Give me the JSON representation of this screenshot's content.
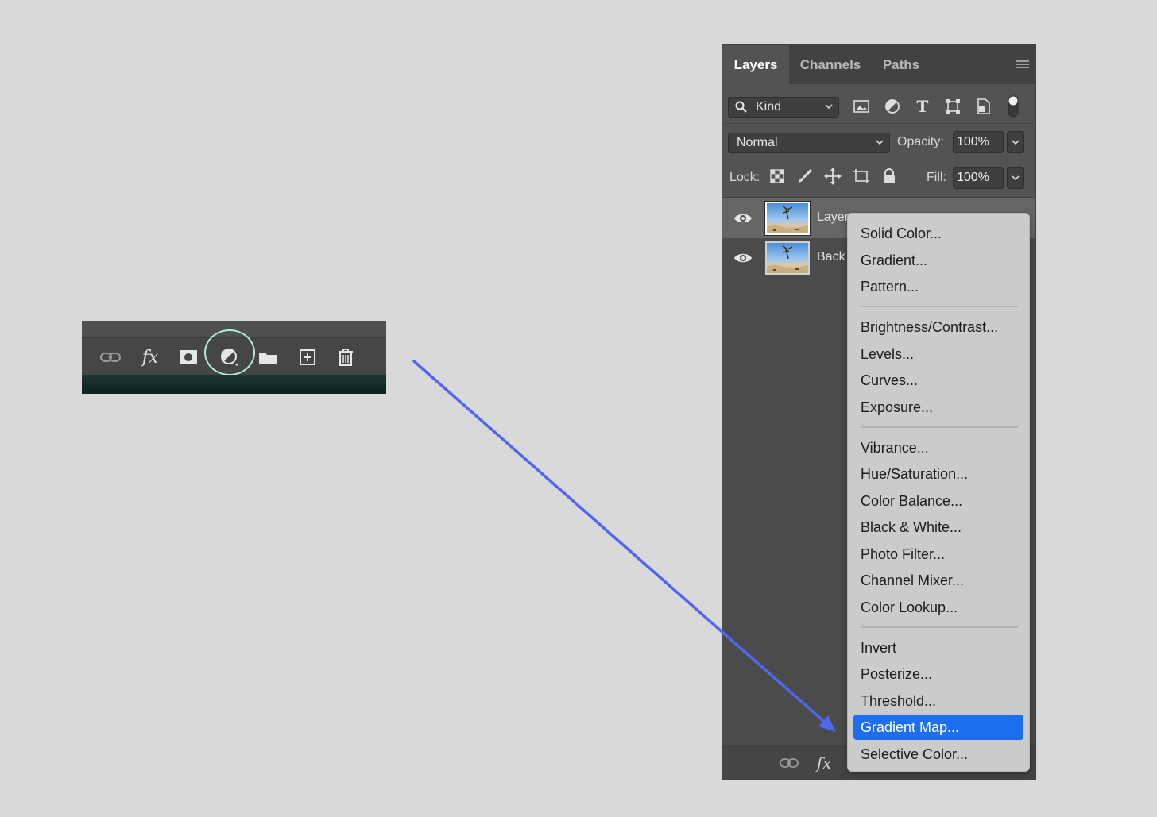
{
  "left_toolbar": {
    "icons": [
      "link-icon",
      "fx-icon",
      "mask-icon",
      "adjustment-layer-icon",
      "folder-icon",
      "new-layer-icon",
      "trash-icon"
    ],
    "fx_text": "fx",
    "highlight_color": "#a9f0d8"
  },
  "arrow": {
    "color": "#4f67f0"
  },
  "panel": {
    "tabs": [
      "Layers",
      "Channels",
      "Paths"
    ],
    "kind_label": "Kind",
    "blend_mode": "Normal",
    "opacity_label": "Opacity:",
    "opacity_value": "100%",
    "lock_label": "Lock:",
    "fill_label": "Fill:",
    "fill_value": "100%",
    "layers": [
      {
        "name": "Layer",
        "selected": true
      },
      {
        "name": "Back",
        "selected": false
      }
    ],
    "bottom_fx": "fx"
  },
  "menu": {
    "items": [
      "Solid Color...",
      "Gradient...",
      "Pattern...",
      "Brightness/Contrast...",
      "Levels...",
      "Curves...",
      "Exposure...",
      "Vibrance...",
      "Hue/Saturation...",
      "Color Balance...",
      "Black & White...",
      "Photo Filter...",
      "Channel Mixer...",
      "Color Lookup...",
      "Invert",
      "Posterize...",
      "Threshold...",
      "Gradient Map...",
      "Selective Color..."
    ],
    "highlighted": "Gradient Map...",
    "highlight_color": "#1e6ff0"
  }
}
